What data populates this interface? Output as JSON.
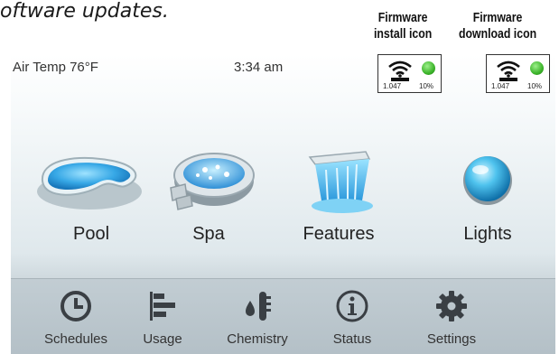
{
  "caption": "oftware updates.",
  "callouts": {
    "install": [
      "Firmware",
      "install icon"
    ],
    "download": [
      "Firmware",
      "download icon"
    ]
  },
  "status_bar": {
    "air_temp": "Air Temp 76°F",
    "time": "3:34 am"
  },
  "firmware_icons": {
    "install": {
      "version": "1.047",
      "progress": "10%",
      "status_color": "#3cb42a"
    },
    "download": {
      "version": "1.047",
      "progress": "10%",
      "status_color": "#3cb42a"
    }
  },
  "features": [
    {
      "label": "Pool",
      "icon": "pool-icon"
    },
    {
      "label": "Spa",
      "icon": "spa-icon"
    },
    {
      "label": "Features",
      "icon": "waterfall-icon"
    },
    {
      "label": "Lights",
      "icon": "light-bulb-icon"
    }
  ],
  "nav": [
    {
      "label": "Schedules",
      "icon": "clock-icon"
    },
    {
      "label": "Usage",
      "icon": "bar-chart-icon"
    },
    {
      "label": "Chemistry",
      "icon": "chemistry-icon"
    },
    {
      "label": "Status",
      "icon": "info-icon"
    },
    {
      "label": "Settings",
      "icon": "gear-icon"
    }
  ],
  "colors": {
    "accent_blue": "#2e8fd6",
    "status_green": "#3cb42a",
    "nav_icon": "#3a3f44"
  }
}
